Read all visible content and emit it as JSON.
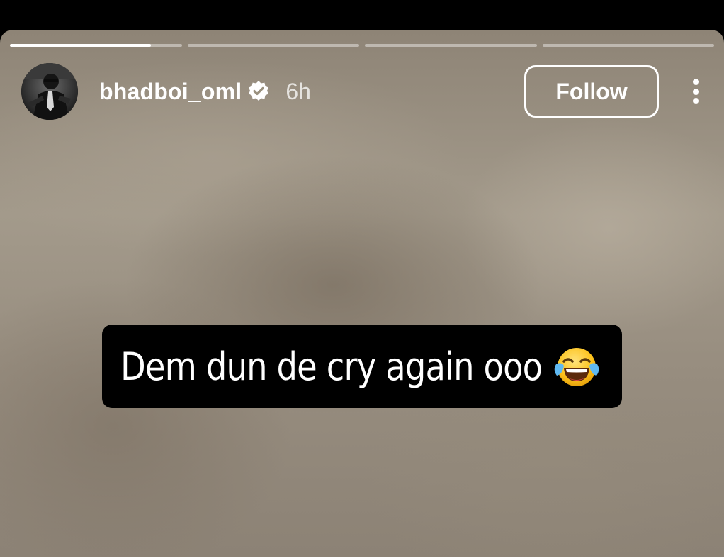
{
  "story": {
    "progress_segments": [
      0.82,
      0,
      0,
      0
    ],
    "user": {
      "username": "bhadboi_oml",
      "verified": true,
      "time_ago": "6h"
    },
    "follow_label": "Follow",
    "caption": "Dem dun de cry again ooo",
    "caption_emoji": "face-with-tears-of-joy-emoji",
    "icons": [
      "verified-badge-icon",
      "more-options-icon"
    ]
  },
  "colors": {
    "caption_bg": "#000000",
    "text": "#ffffff"
  }
}
